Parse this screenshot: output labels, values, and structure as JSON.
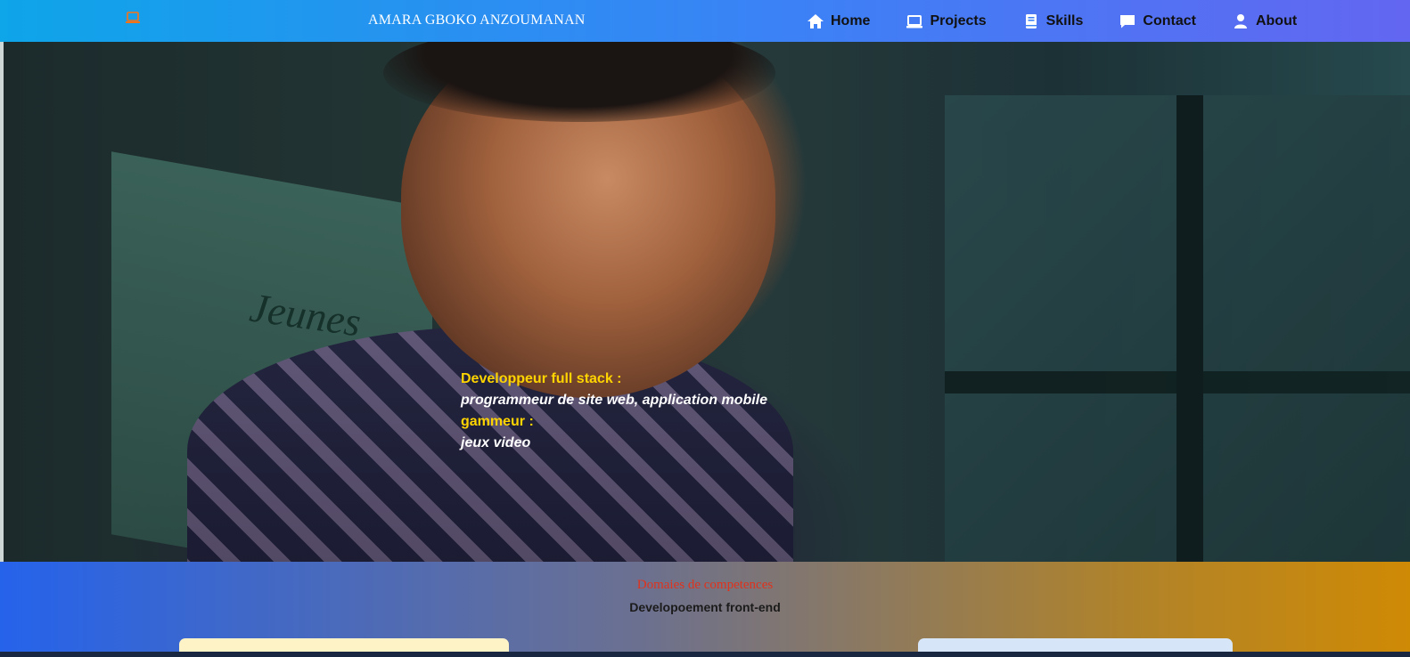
{
  "navbar": {
    "logo_icon": "laptop-icon",
    "brand": "AMARA GBOKO ANZOUMANAN",
    "items": [
      {
        "label": "Home",
        "icon": "home-icon"
      },
      {
        "label": "Projects",
        "icon": "laptop-icon"
      },
      {
        "label": "Skills",
        "icon": "book-icon"
      },
      {
        "label": "Contact",
        "icon": "chat-icon"
      },
      {
        "label": "About",
        "icon": "user-icon"
      }
    ]
  },
  "hero": {
    "board_text": "Jeunes",
    "lines": [
      {
        "text": "Developpeur full stack :",
        "style": "label"
      },
      {
        "text": "programmeur de site web, application mobile",
        "style": "value"
      },
      {
        "text": "gammeur :",
        "style": "label"
      },
      {
        "text": "jeux video",
        "style": "value"
      }
    ]
  },
  "competences": {
    "title": "Domaies de competences",
    "subtitle": "Developoement front-end"
  },
  "colors": {
    "accent_yellow": "#ffd400",
    "title_red": "#e0321c",
    "logo_orange": "#f97316"
  }
}
